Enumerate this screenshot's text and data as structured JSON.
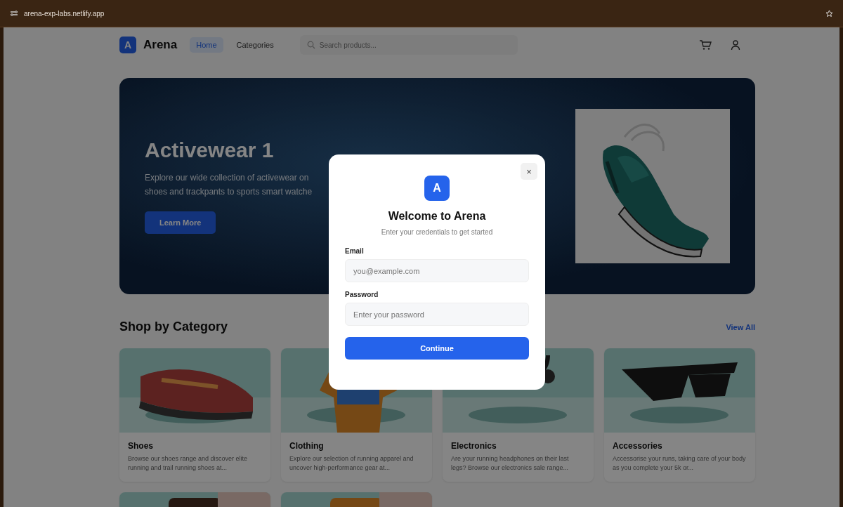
{
  "browser": {
    "url": "arena-exp-labs.netlify.app"
  },
  "nav": {
    "logo_letter": "A",
    "brand": "Arena",
    "links": [
      {
        "label": "Home",
        "selected": true
      },
      {
        "label": "Categories",
        "selected": false
      }
    ],
    "search": {
      "placeholder": "Search products..."
    }
  },
  "hero": {
    "title": "Activewear 1",
    "lines": [
      "Explore our wide collection of activewear on",
      "shoes and trackpants to sports smart watche"
    ],
    "button": "Learn More"
  },
  "section": {
    "title": "Shop by Category",
    "link": "View All"
  },
  "categories": [
    {
      "name": "Shoes",
      "description": "Browse our shoes range and discover elite running and trail running shoes at..."
    },
    {
      "name": "Clothing",
      "description": "Explore our selection of running apparel and uncover high-performance gear at..."
    },
    {
      "name": "Electronics",
      "description": "Are your running headphones on their last legs? Browse our electronics sale range..."
    },
    {
      "name": "Accessories",
      "description": "Accessorise your runs, taking care of your body as you complete your 5k or..."
    }
  ],
  "modal": {
    "logo_letter": "A",
    "close": "×",
    "title": "Welcome to Arena",
    "subtitle": "Enter your credentials to get started",
    "fields": [
      {
        "label": "Email",
        "placeholder": "you@example.com"
      },
      {
        "label": "Password",
        "placeholder": "Enter your password"
      }
    ],
    "button": "Continue"
  }
}
